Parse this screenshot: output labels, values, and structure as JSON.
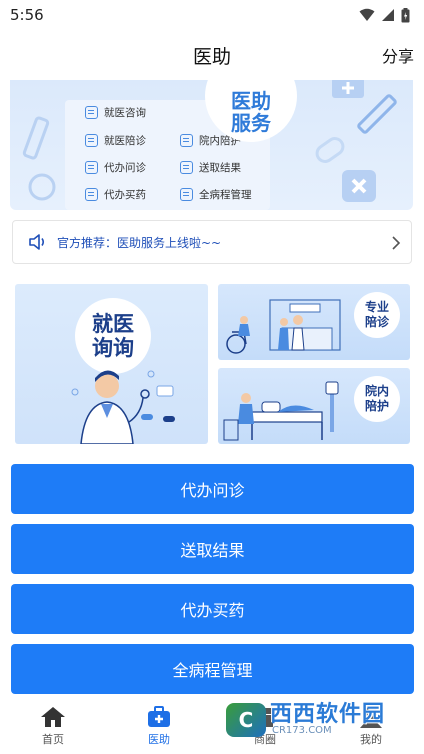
{
  "status_bar": {
    "time": "5:56"
  },
  "header": {
    "title": "医助",
    "share": "分享"
  },
  "banner": {
    "bubble_line1": "医助",
    "bubble_line2": "服务",
    "services": [
      {
        "label": "就医咨询",
        "icon": "chat-icon"
      },
      {
        "label": "就医陪诊",
        "icon": "list-icon"
      },
      {
        "label": "院内陪护",
        "icon": "plus-cross-icon"
      },
      {
        "label": "代办问诊",
        "icon": "document-icon"
      },
      {
        "label": "送取结果",
        "icon": "bag-icon"
      },
      {
        "label": "代办买药",
        "icon": "pill-icon"
      },
      {
        "label": "全病程管理",
        "icon": "heart-monitor-icon"
      }
    ]
  },
  "notice": {
    "text": "官方推荐：医助服务上线啦~~",
    "icon": "speaker-icon"
  },
  "cards": {
    "consult": {
      "line1": "就医",
      "line2": "询询"
    },
    "escort": {
      "line1": "专业",
      "line2": "陪诊"
    },
    "care": {
      "line1": "院内",
      "line2": "陪护"
    }
  },
  "actions": [
    {
      "label": "代办问诊"
    },
    {
      "label": "送取结果"
    },
    {
      "label": "代办买药"
    },
    {
      "label": "全病程管理"
    }
  ],
  "nav": [
    {
      "label": "首页",
      "icon": "home-icon"
    },
    {
      "label": "医助",
      "icon": "medical-kit-icon"
    },
    {
      "label": "商圈",
      "icon": "shop-icon"
    },
    {
      "label": "我的",
      "icon": "user-icon"
    }
  ],
  "watermark": {
    "main": "西西软件园",
    "sub": "CR173.COM"
  },
  "colors": {
    "primary": "#1e7cf7",
    "nav_active": "#1e6fe6",
    "notice_text": "#1f4fb8"
  }
}
